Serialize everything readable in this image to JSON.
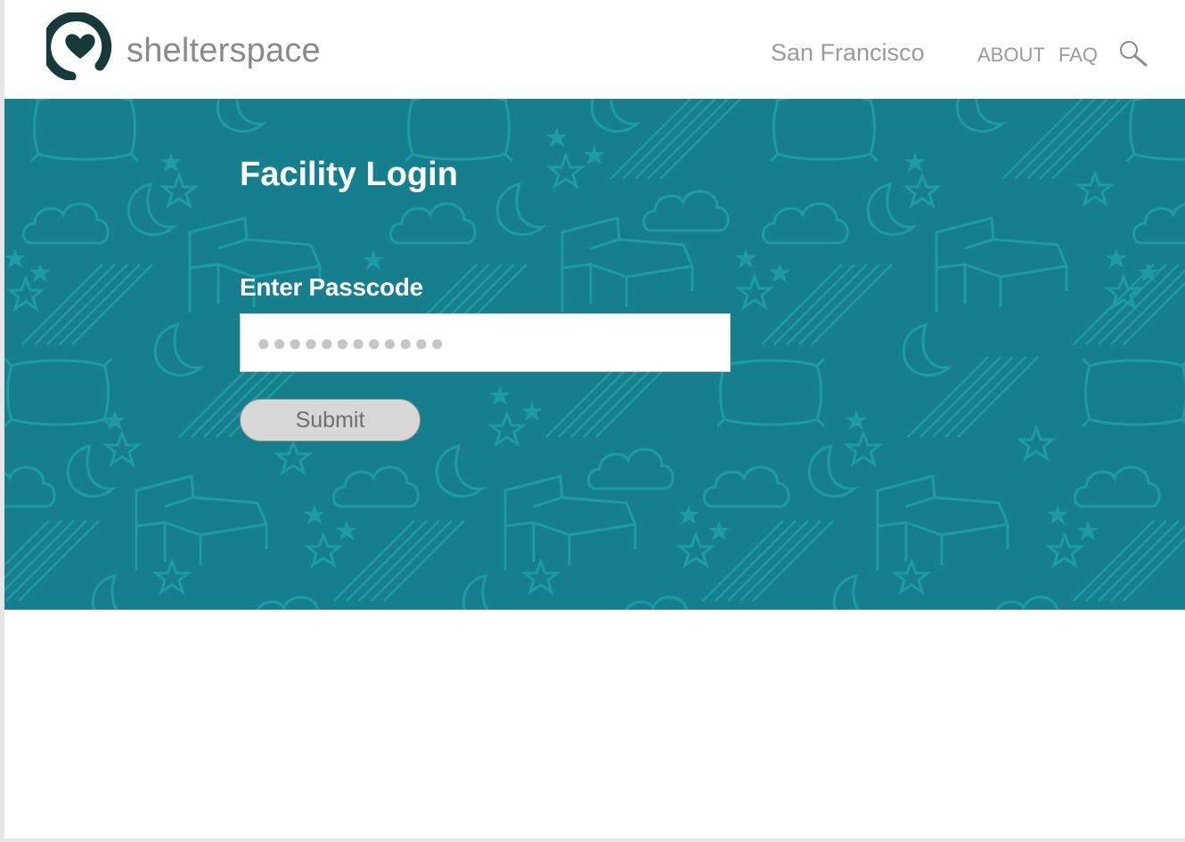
{
  "header": {
    "brand_name": "shelterspace",
    "city": "San Francisco",
    "nav": {
      "about_label": "ABOUT",
      "faq_label": "FAQ"
    },
    "icons": {
      "logo": "heart-location-logo",
      "search": "search-icon"
    }
  },
  "login": {
    "title": "Facility Login",
    "passcode_label": "Enter Passcode",
    "passcode_placeholder": "●●●●●●●●●●●●",
    "submit_label": "Submit"
  },
  "colors": {
    "brand_dark": "#163a3a",
    "hero_background": "#167f8d",
    "pattern_line": "#1f9ba6"
  }
}
